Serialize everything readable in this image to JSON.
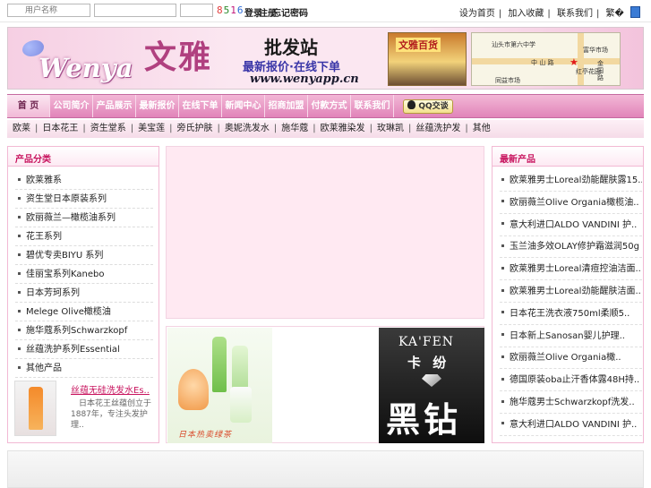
{
  "topbar": {
    "username_placeholder": "用户名称",
    "password_value": "",
    "captcha_value": "",
    "captcha_code": "8516",
    "captcha_colors": [
      "#e23b3b",
      "#2a8a2a",
      "#c2187a",
      "#2a6ad8"
    ],
    "login_label": "登录",
    "register_label": "注册",
    "forgot_label": "忘记密码",
    "links": [
      "设为首页",
      "加入收藏",
      "联系我们",
      "繁�"
    ]
  },
  "banner": {
    "logo_en": "Wenya",
    "logo_cn": "文雅",
    "wholesale": "批发站",
    "slogan": "最新报价·在线下单",
    "url": "www.wenyapp.cn",
    "shop_sign": "文雅百货",
    "map_labels": [
      "汕头市第六中学",
      "富华市场",
      "中 山 路",
      "红亭花园",
      "同益市场",
      "金园路"
    ]
  },
  "nav": {
    "items": [
      "首 页",
      "公司简介",
      "产品展示",
      "最新报价",
      "在线下单",
      "新闻中心",
      "招商加盟",
      "付款方式",
      "联系我们"
    ],
    "qq_label": "QQ交谈"
  },
  "subnav": {
    "items": [
      "欧莱",
      "日本花王",
      "资生堂系",
      "美宝莲",
      "旁氏护肤",
      "奥妮洗发水",
      "施华蔻",
      "欧莱雅染发",
      "玫琳凯",
      "丝蕴洗护发",
      "其他"
    ]
  },
  "left_panel": {
    "title": "产品分类",
    "items": [
      "欧莱雅系",
      "资生堂日本原装系列",
      "欧丽薇兰—橄榄油系列",
      "花王系列",
      "碧优专卖BIYU 系列",
      "佳丽宝系列Kanebo",
      "日本芳珂系列",
      "Melege Olive橄榄油",
      "施华蔻系列Schwarzkopf",
      "丝蕴洗护系列Essential",
      "其他产品"
    ],
    "product_title": "丝蕴无硅洗发水Es..",
    "product_desc": "日本花王丝蕴创立于1887年，专注头发护理.."
  },
  "right_panel": {
    "title": "最新产品",
    "items": [
      "欧莱雅男士Loreal劲能醒肤露15..",
      "欧丽薇兰Olive Organia橄榄油..",
      "意大利进口ALDO VANDINI 护..",
      "玉兰油多效OLAY修护霜滋润50g",
      "欧莱雅男士Loreal清痘控油洁面..",
      "欧莱雅男士Loreal劲能醒肤洁面..",
      "日本花王洗衣液750ml柔顺5..",
      "日本新上Sanosan婴儿护理..",
      "欧丽薇兰Olive Organia橄..",
      "德国原装oba止汗香体露48H持..",
      "施华蔻男士Schwarzkopf洗发..",
      "意大利进口ALDO VANDINI 护.."
    ]
  },
  "promo": {
    "left_caption": "日本热卖绿茶",
    "right_brand_en": "KA'FEN",
    "right_brand_cn": "卡 纷",
    "right_product": "黑钻"
  },
  "colors": {
    "accent": "#c8155f",
    "nav_bg": "#e184b9",
    "panel_border": "#f2b9d4",
    "flash_bg": "#ffe9f2"
  }
}
